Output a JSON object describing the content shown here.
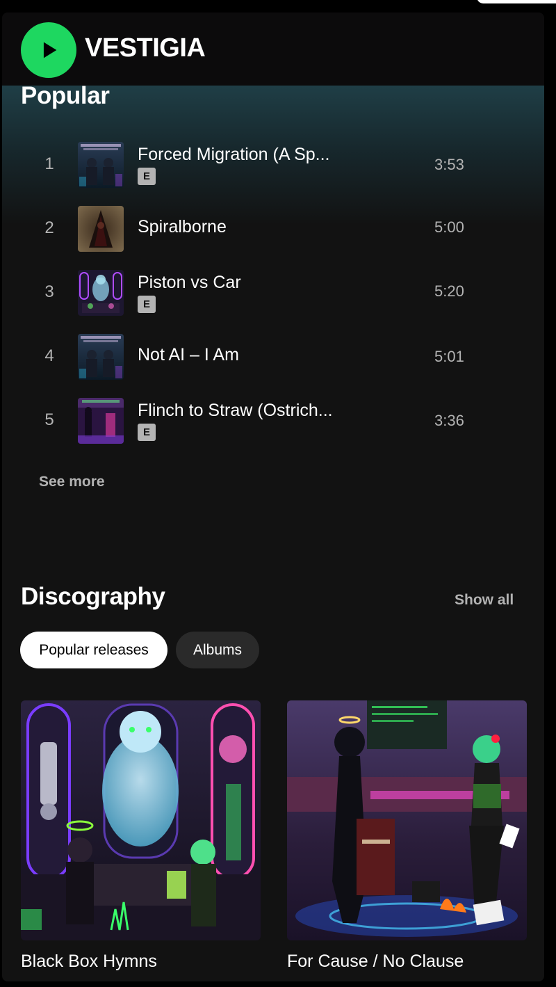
{
  "artist": {
    "name": "VESTIGIA"
  },
  "popular": {
    "title": "Popular",
    "tracks": [
      {
        "num": "1",
        "title": "Forced Migration (A Sp...",
        "explicit": "E",
        "duration": "3:53"
      },
      {
        "num": "2",
        "title": "Spiralborne",
        "duration": "5:00"
      },
      {
        "num": "3",
        "title": "Piston vs Car",
        "explicit": "E",
        "duration": "5:20"
      },
      {
        "num": "4",
        "title": "Not AI – I Am",
        "duration": "5:01"
      },
      {
        "num": "5",
        "title": "Flinch to Straw (Ostrich...",
        "explicit": "E",
        "duration": "3:36"
      }
    ],
    "see_more": "See more"
  },
  "discography": {
    "title": "Discography",
    "show_all": "Show all",
    "filters": [
      "Popular releases",
      "Albums"
    ],
    "releases": [
      {
        "title": "Black Box Hymns"
      },
      {
        "title": "For Cause / No Clause"
      }
    ]
  },
  "colors": {
    "accent": "#1ed760",
    "background": "#121212",
    "header": "#0c0b0c",
    "muted_text": "#b3b3b3"
  },
  "icons": {
    "play": "play-icon",
    "explicit": "explicit-badge"
  }
}
